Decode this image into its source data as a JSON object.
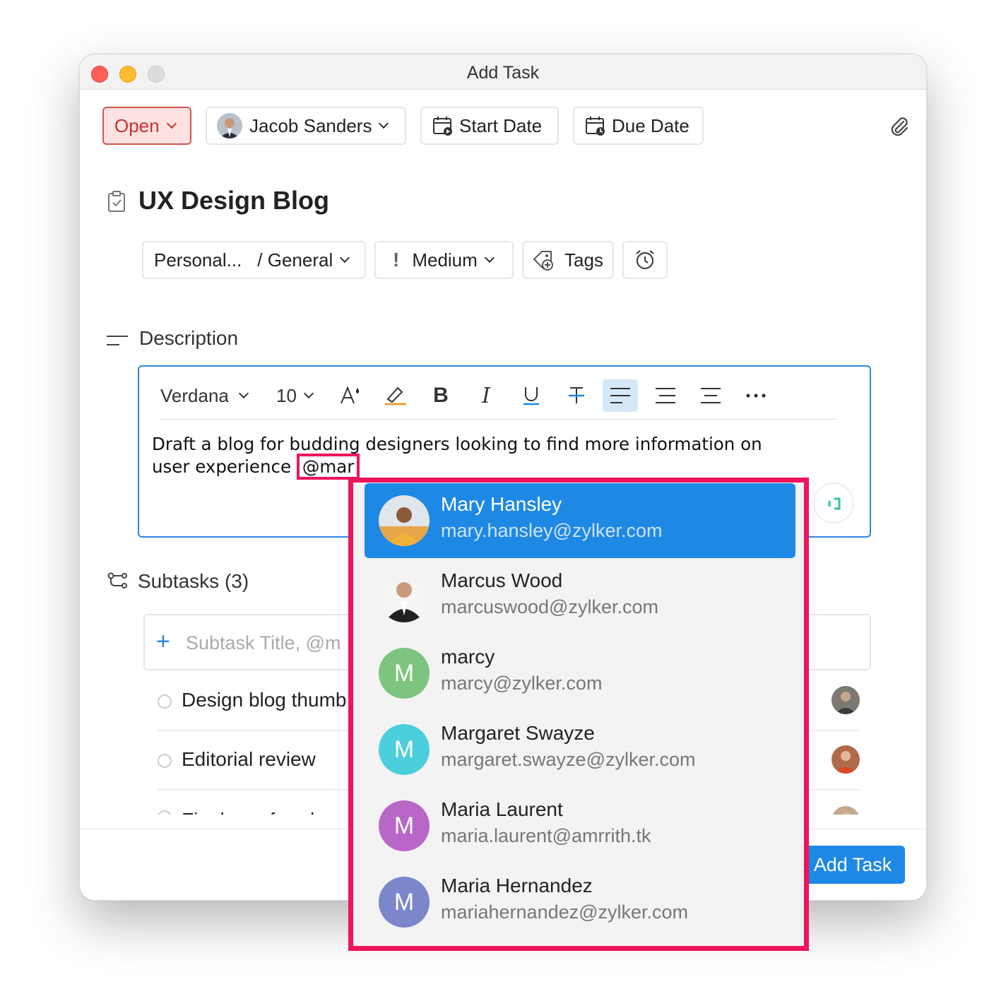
{
  "window": {
    "title": "Add Task"
  },
  "toolbar": {
    "status": "Open",
    "owner": "Jacob Sanders",
    "start_date": "Start Date",
    "due_date": "Due Date"
  },
  "task": {
    "title": "UX Design Blog"
  },
  "meta": {
    "project": "Personal...",
    "tasklist": "/ General",
    "priority": "Medium",
    "tags": "Tags"
  },
  "description": {
    "label": "Description",
    "font": "Verdana",
    "size": "10",
    "text_line1": "Draft a blog for budding designers looking to find more information on",
    "text_line2": "user experience",
    "mention": "@mar"
  },
  "subtasks": {
    "label": "Subtasks (3)",
    "placeholder": "Subtask Title, @m",
    "items": [
      {
        "title": "Design blog thumb"
      },
      {
        "title": "Editorial review"
      },
      {
        "title": "Final proofread"
      }
    ]
  },
  "footer": {
    "add_task": "Add Task"
  },
  "mention_suggestions": [
    {
      "name": "Mary Hansley",
      "email": "mary.hansley@zylker.com",
      "initial": "",
      "color": "#e8a64a",
      "selected": true
    },
    {
      "name": "Marcus Wood",
      "email": "marcuswood@zylker.com",
      "initial": "",
      "color": "#444444",
      "selected": false
    },
    {
      "name": "marcy",
      "email": "marcy@zylker.com",
      "initial": "M",
      "color": "#7dc57e",
      "selected": false
    },
    {
      "name": "Margaret Swayze",
      "email": "margaret.swayze@zylker.com",
      "initial": "M",
      "color": "#4ccfdc",
      "selected": false
    },
    {
      "name": "Maria Laurent",
      "email": "maria.laurent@amrrith.tk",
      "initial": "M",
      "color": "#b966c9",
      "selected": false
    },
    {
      "name": "Maria Hernandez",
      "email": "mariahernandez@zylker.com",
      "initial": "M",
      "color": "#7b86cb",
      "selected": false
    }
  ],
  "colors": {
    "accent": "#1e88e5",
    "status_open": "#c9302c",
    "highlight": "#f0145a"
  }
}
